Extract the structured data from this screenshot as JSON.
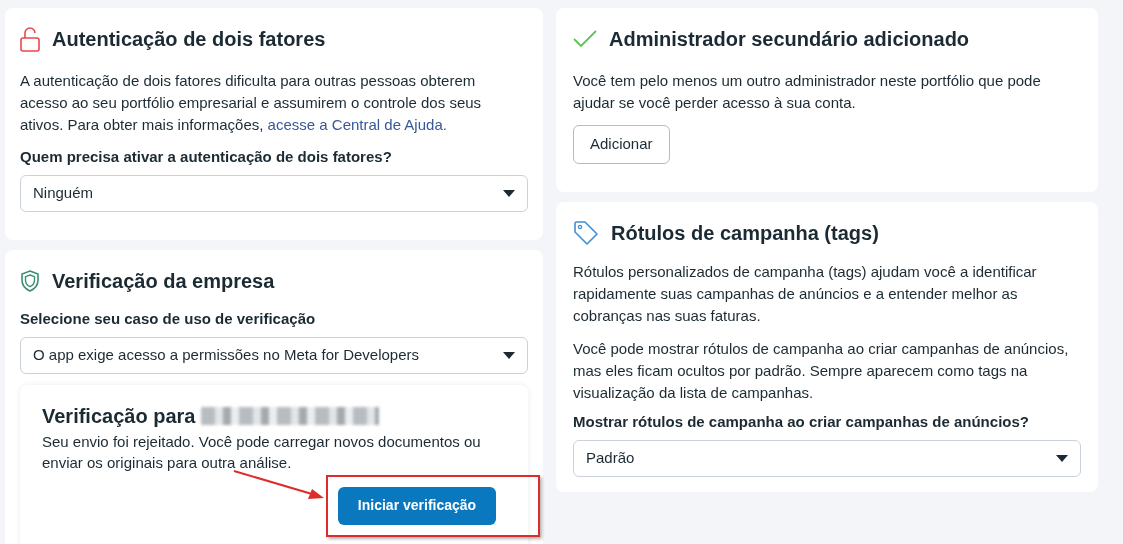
{
  "two_factor": {
    "title": "Autenticação de dois fatores",
    "description": "A autenticação de dois fatores dificulta para outras pessoas obterem acesso ao seu portfólio empresarial e assumirem o controle dos seus ativos. Para obter mais informações, ",
    "link": "acesse a Central de Ajuda.",
    "question": "Quem precisa ativar a autenticação de dois fatores?",
    "select_value": "Ninguém"
  },
  "business_verification": {
    "title": "Verificação da empresa",
    "label": "Selecione seu caso de uso de verificação",
    "select_value": "O app exige acesso a permissões no Meta for Developers",
    "status_card": {
      "title": "Verificação para",
      "redacted": true,
      "message": "Seu envio foi rejeitado. Você pode carregar novos documentos ou enviar os originais para outra análise.",
      "button": "Iniciar verificação"
    }
  },
  "secondary_admin": {
    "title": "Administrador secundário adicionado",
    "description": "Você tem pelo menos um outro administrador neste portfólio que pode ajudar se você perder acesso à sua conta.",
    "button": "Adicionar"
  },
  "campaign_tags": {
    "title": "Rótulos de campanha (tags)",
    "paragraphs": [
      "Rótulos personalizados de campanha (tags) ajudam você a identificar rapidamente suas campanhas de anúncios e a entender melhor as cobranças nas suas faturas.",
      "Você pode mostrar rótulos de campanha ao criar campanhas de anúncios, mas eles ficam ocultos por padrão. Sempre aparecem como tags na visualização da lista de campanhas."
    ],
    "question": "Mostrar rótulos de campanha ao criar campanhas de anúncios?",
    "select_value": "Padrão"
  },
  "annotation": {
    "arrow": true,
    "highlight": true
  }
}
